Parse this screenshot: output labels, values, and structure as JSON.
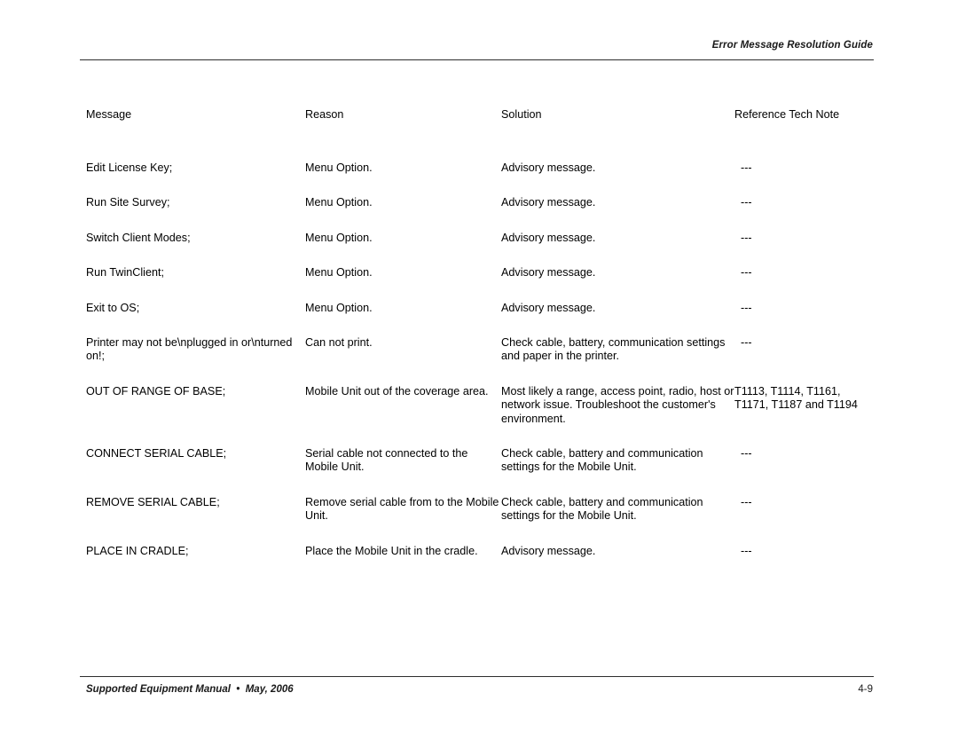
{
  "header": {
    "title": "Error Message Resolution Guide"
  },
  "footer": {
    "manual": "Supported Equipment Manual  •  May, 2006",
    "page_number": "4-9"
  },
  "table": {
    "columns": [
      "Message",
      "Reason",
      "Solution",
      "Reference Tech Note"
    ],
    "rows": [
      {
        "message": "Edit License Key;",
        "reason": "Menu Option.",
        "solution": "Advisory message.",
        "reference": "---",
        "bold_message": false
      },
      {
        "message": "Run Site Survey;",
        "reason": "Menu Option.",
        "solution": "Advisory message.",
        "reference": "---",
        "bold_message": false
      },
      {
        "message": "Switch Client Modes;",
        "reason": "Menu Option.",
        "solution": "Advisory message.",
        "reference": "---",
        "bold_message": false
      },
      {
        "message": "Run TwinClient;",
        "reason": "Menu Option.",
        "solution": "Advisory message.",
        "reference": "---",
        "bold_message": false
      },
      {
        "message": "Exit to OS;",
        "reason": "Menu Option.",
        "solution": "Advisory message.",
        "reference": "---",
        "bold_message": false
      },
      {
        "message": "Printer may not be\\nplugged in or\\nturned on!;",
        "reason": "Can not print.",
        "solution": "Check cable, battery, communication settings and paper in the printer.",
        "reference": "---",
        "bold_message": false
      },
      {
        "message": "OUT OF RANGE OF BASE;",
        "reason": "Mobile Unit out of the coverage area.",
        "solution": "Most likely a range, access point, radio, host or network issue. Troubleshoot the customer's environment.",
        "reference": "T1113, T1114, T1161, T1171, T1187 and T1194",
        "bold_message": false
      },
      {
        "message": "CONNECT SERIAL CABLE;",
        "reason": "Serial cable not connected to the Mobile Unit.",
        "solution": "Check cable, battery and communication settings for the Mobile Unit.",
        "reference": "---",
        "bold_message": false
      },
      {
        "message": "REMOVE SERIAL CABLE;",
        "reason": "Remove serial cable from to the Mobile Unit.",
        "solution": "Check cable, battery and communication settings for the Mobile Unit.",
        "reference": "---",
        "bold_message": false
      },
      {
        "message": "PLACE IN CRADLE;",
        "reason": "Place the Mobile Unit in the cradle.",
        "solution": "Advisory message.",
        "reference": "---",
        "bold_message": false
      }
    ]
  }
}
